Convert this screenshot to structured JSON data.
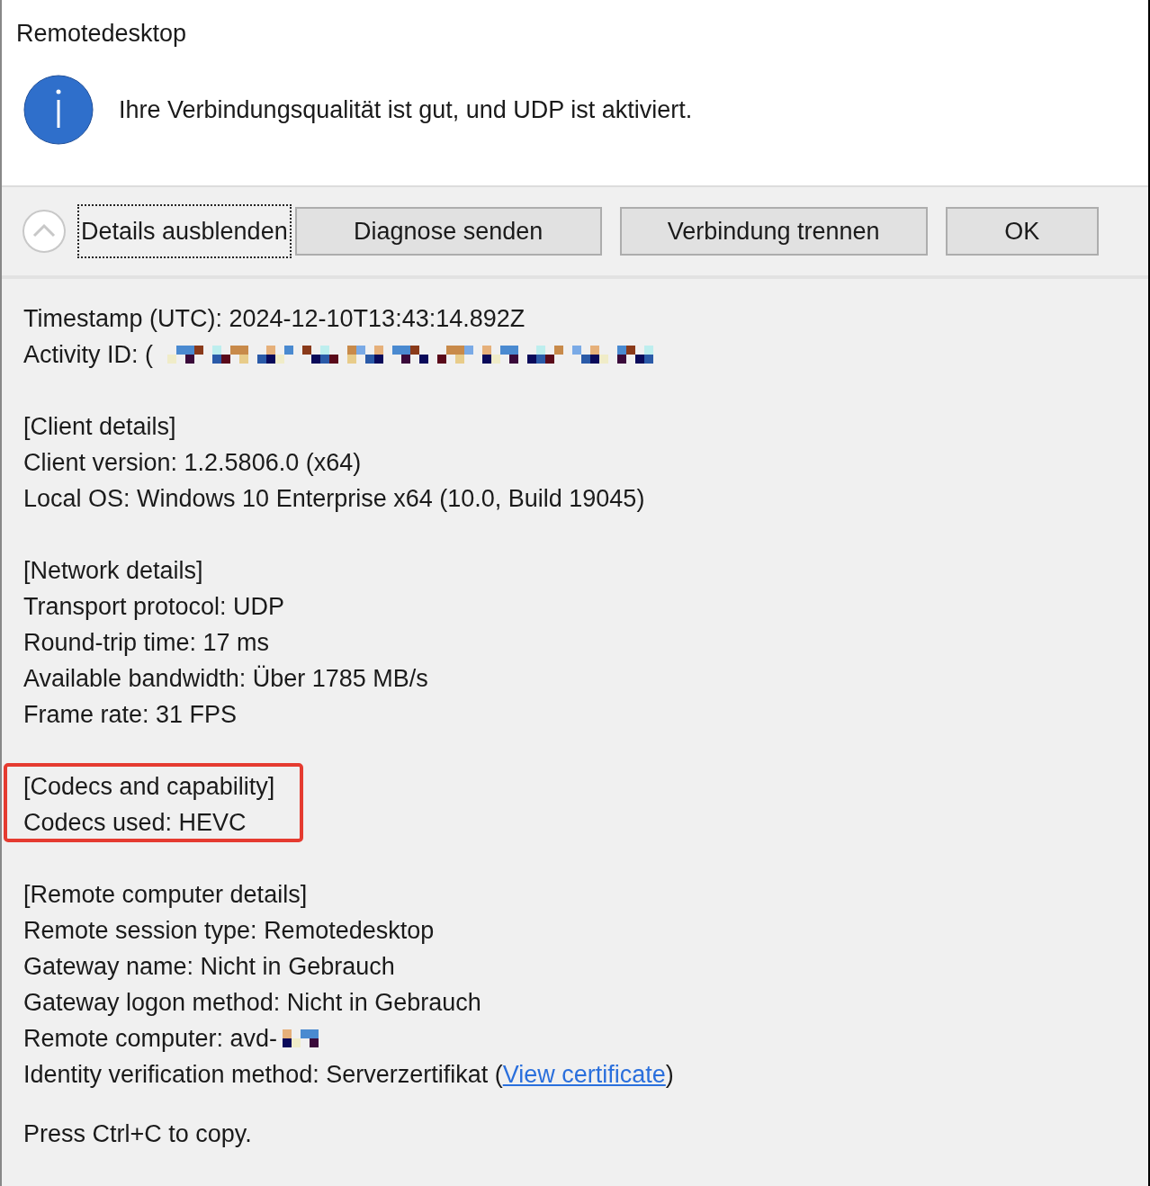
{
  "window": {
    "title": "Remotedesktop"
  },
  "message": {
    "kind": "info",
    "text": "Ihre Verbindungsqualität ist gut, und UDP ist aktiviert."
  },
  "toggle": {
    "label": "Details ausblenden",
    "expanded": true,
    "focused": true
  },
  "buttons": [
    "Diagnose senden",
    "Verbindung trennen",
    "OK"
  ],
  "sections": [
    {
      "lines": [
        {
          "kind": "plain",
          "text": "Timestamp (UTC): 2024-12-10T13:43:14.892Z"
        },
        {
          "kind": "redacted",
          "text": "Activity ID: ("
        }
      ]
    },
    {
      "heading": "[Client details]",
      "lines": [
        {
          "kind": "plain",
          "text": "Client version: 1.2.5806.0 (x64)"
        },
        {
          "kind": "plain",
          "text": "Local OS: Windows 10 Enterprise x64 (10.0, Build 19045)"
        }
      ]
    },
    {
      "heading": "[Network details]",
      "lines": [
        {
          "kind": "plain",
          "text": "Transport protocol: UDP"
        },
        {
          "kind": "plain",
          "text": "Round-trip time: 17 ms"
        },
        {
          "kind": "plain",
          "text": "Available bandwidth: Über 1785 MB/s"
        },
        {
          "kind": "plain",
          "text": "Frame rate: 31 FPS"
        }
      ]
    },
    {
      "heading": "[Codecs and capability]",
      "highlighted": true,
      "lines": [
        {
          "kind": "plain",
          "text": "Codecs used: HEVC"
        }
      ]
    },
    {
      "heading": "[Remote computer details]",
      "lines": [
        {
          "kind": "plain",
          "text": "Remote session type: Remotedesktop"
        },
        {
          "kind": "plain",
          "text": "Gateway name: Nicht in Gebrauch"
        },
        {
          "kind": "plain",
          "text": "Gateway logon method: Nicht in Gebrauch"
        },
        {
          "kind": "redacted",
          "text": "Remote computer: avd-"
        },
        {
          "kind": "link",
          "text": "Identity verification method: Serverzertifikat (",
          "link": "View certificate",
          "after": ")"
        }
      ]
    }
  ],
  "footer": "Press Ctrl+C to copy."
}
